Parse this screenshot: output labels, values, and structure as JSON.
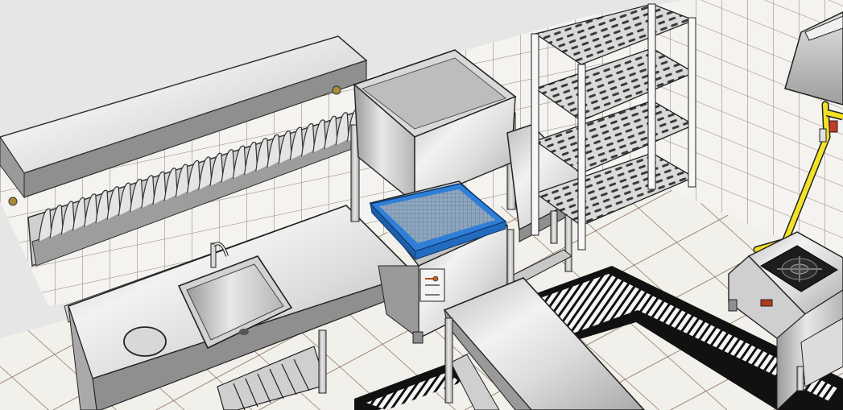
{
  "scene": {
    "title": "",
    "colors": {
      "wall": "#e6e6e6",
      "wall_tile": "#f4f3ef",
      "tile_grout": "#8a7f73",
      "floor_tile": "#f2f0ea",
      "floor_grout": "#7b5a4b",
      "steel_light": "#e9e9e9",
      "steel_mid": "#c8c8c8",
      "steel_dark": "#8f8f8f",
      "rack_blue": "#2f7fd8",
      "gas_pipe": "#f2e125",
      "drain": "#111111"
    },
    "icons": [
      "faucet-icon",
      "burner-icon",
      "gauge-icon"
    ]
  }
}
